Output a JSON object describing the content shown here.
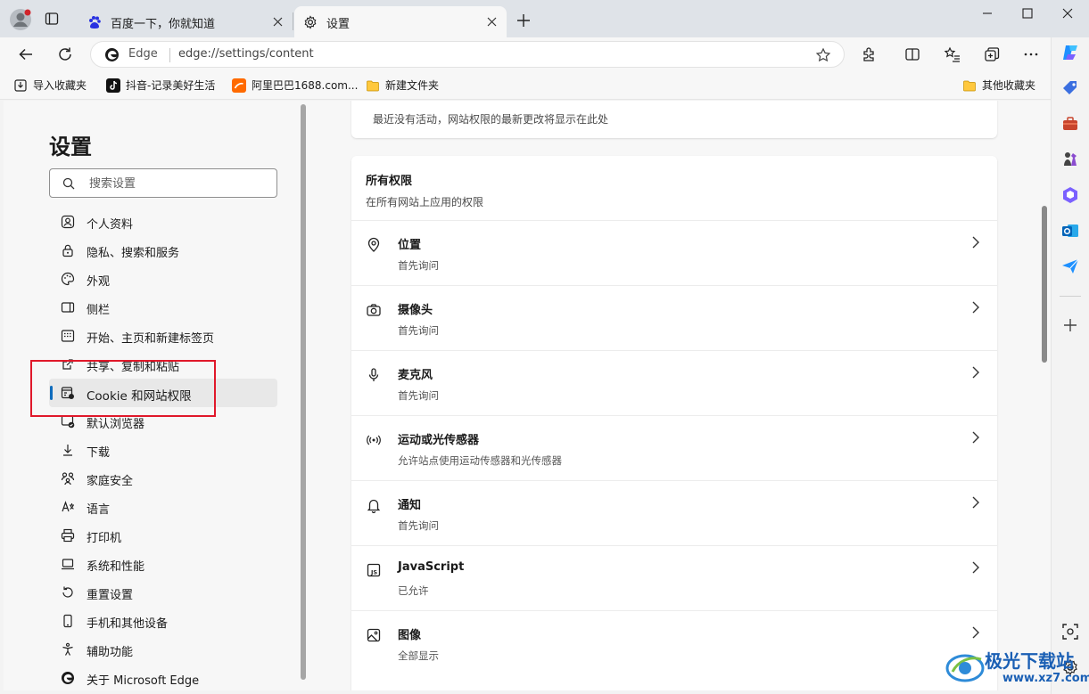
{
  "tabs": [
    {
      "title": "百度一下，你就知道",
      "favicon": "baidu-icon",
      "active": false
    },
    {
      "title": "设置",
      "favicon": "gear-icon",
      "active": true
    }
  ],
  "address_bar": {
    "brand": "Edge",
    "url": "edge://settings/content"
  },
  "bookmarks": [
    {
      "label": "导入收藏夹",
      "icon": "import-icon"
    },
    {
      "label": "抖音-记录美好生活",
      "icon": "tiktok-icon"
    },
    {
      "label": "阿里巴巴1688.com...",
      "icon": "alibaba-icon"
    },
    {
      "label": "新建文件夹",
      "icon": "folder-icon"
    },
    {
      "label": "其他收藏夹",
      "icon": "folder-icon"
    }
  ],
  "settings": {
    "title": "设置",
    "search_placeholder": "搜索设置",
    "nav": [
      {
        "label": "个人资料",
        "icon": "profile-icon"
      },
      {
        "label": "隐私、搜索和服务",
        "icon": "lock-icon"
      },
      {
        "label": "外观",
        "icon": "palette-icon"
      },
      {
        "label": "侧栏",
        "icon": "sidebar-icon"
      },
      {
        "label": "开始、主页和新建标签页",
        "icon": "home-tab-icon"
      },
      {
        "label": "共享、复制和粘贴",
        "icon": "share-icon"
      },
      {
        "label": "Cookie 和网站权限",
        "icon": "cookie-permissions-icon",
        "selected": true
      },
      {
        "label": "默认浏览器",
        "icon": "default-browser-icon"
      },
      {
        "label": "下载",
        "icon": "download-icon"
      },
      {
        "label": "家庭安全",
        "icon": "family-icon"
      },
      {
        "label": "语言",
        "icon": "language-icon"
      },
      {
        "label": "打印机",
        "icon": "printer-icon"
      },
      {
        "label": "系统和性能",
        "icon": "laptop-icon"
      },
      {
        "label": "重置设置",
        "icon": "reset-icon"
      },
      {
        "label": "手机和其他设备",
        "icon": "phone-icon"
      },
      {
        "label": "辅助功能",
        "icon": "accessibility-icon"
      },
      {
        "label": "关于 Microsoft Edge",
        "icon": "edge-icon"
      }
    ]
  },
  "content": {
    "recent_activity_text": "最近没有活动，网站权限的最新更改将显示在此处",
    "all_permissions": {
      "title": "所有权限",
      "subtitle": "在所有网站上应用的权限",
      "items": [
        {
          "title": "位置",
          "status": "首先询问",
          "icon": "location-icon"
        },
        {
          "title": "摄像头",
          "status": "首先询问",
          "icon": "camera-icon"
        },
        {
          "title": "麦克风",
          "status": "首先询问",
          "icon": "microphone-icon"
        },
        {
          "title": "运动或光传感器",
          "status": "允许站点使用运动传感器和光传感器",
          "icon": "sensor-icon"
        },
        {
          "title": "通知",
          "status": "首先询问",
          "icon": "bell-icon"
        },
        {
          "title": "JavaScript",
          "status": "已允许",
          "icon": "javascript-icon"
        },
        {
          "title": "图像",
          "status": "全部显示",
          "icon": "image-icon"
        }
      ]
    }
  },
  "watermark": {
    "name": "极光下载站",
    "url": "www.xz7.com"
  },
  "colors": {
    "accent": "#0f6cbd",
    "highlight_box": "#e0182a"
  }
}
